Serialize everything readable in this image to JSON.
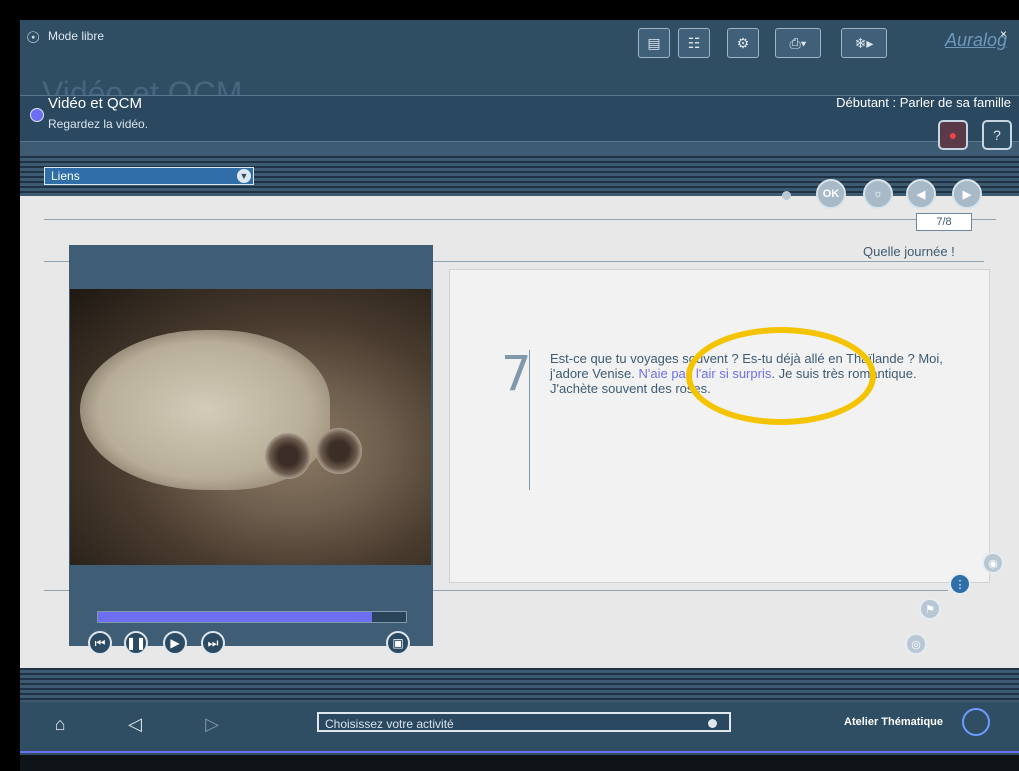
{
  "window": {
    "mode_label": "Mode libre",
    "close_glyph": "×"
  },
  "header": {
    "brand": "Auralog",
    "toolbar_icons": [
      "document-icon",
      "book-icon",
      "settings-icon",
      "print-icon",
      "walker-icon"
    ],
    "ghost_title": "Vidéo et QCM"
  },
  "activity": {
    "title": "Vidéo et QCM",
    "subtitle": "Regardez la vidéo.",
    "level": "Débutant : Parler de sa famille"
  },
  "links": {
    "label": "Liens"
  },
  "nav": {
    "ok_label": "OK",
    "page": "7/8"
  },
  "section": {
    "title": "Quelle journée !"
  },
  "exercise": {
    "number": "7",
    "text_before": "Est-ce que tu voyages souvent ? Es-tu déjà allé en Thaïlande ? Moi, j'adore Venise. ",
    "text_highlight": "N'aie pas l'air si surpris",
    "text_after": ". Je suis très romantique. J'achète souvent des roses."
  },
  "video": {
    "progress": 0.89
  },
  "bottom": {
    "chooser_placeholder": "Choisissez votre activité",
    "atelier_label": "Atelier Thématique"
  },
  "colors": {
    "accent": "#6e6ef2",
    "annotation": "#f5c400",
    "panel": "#3d5b73"
  }
}
